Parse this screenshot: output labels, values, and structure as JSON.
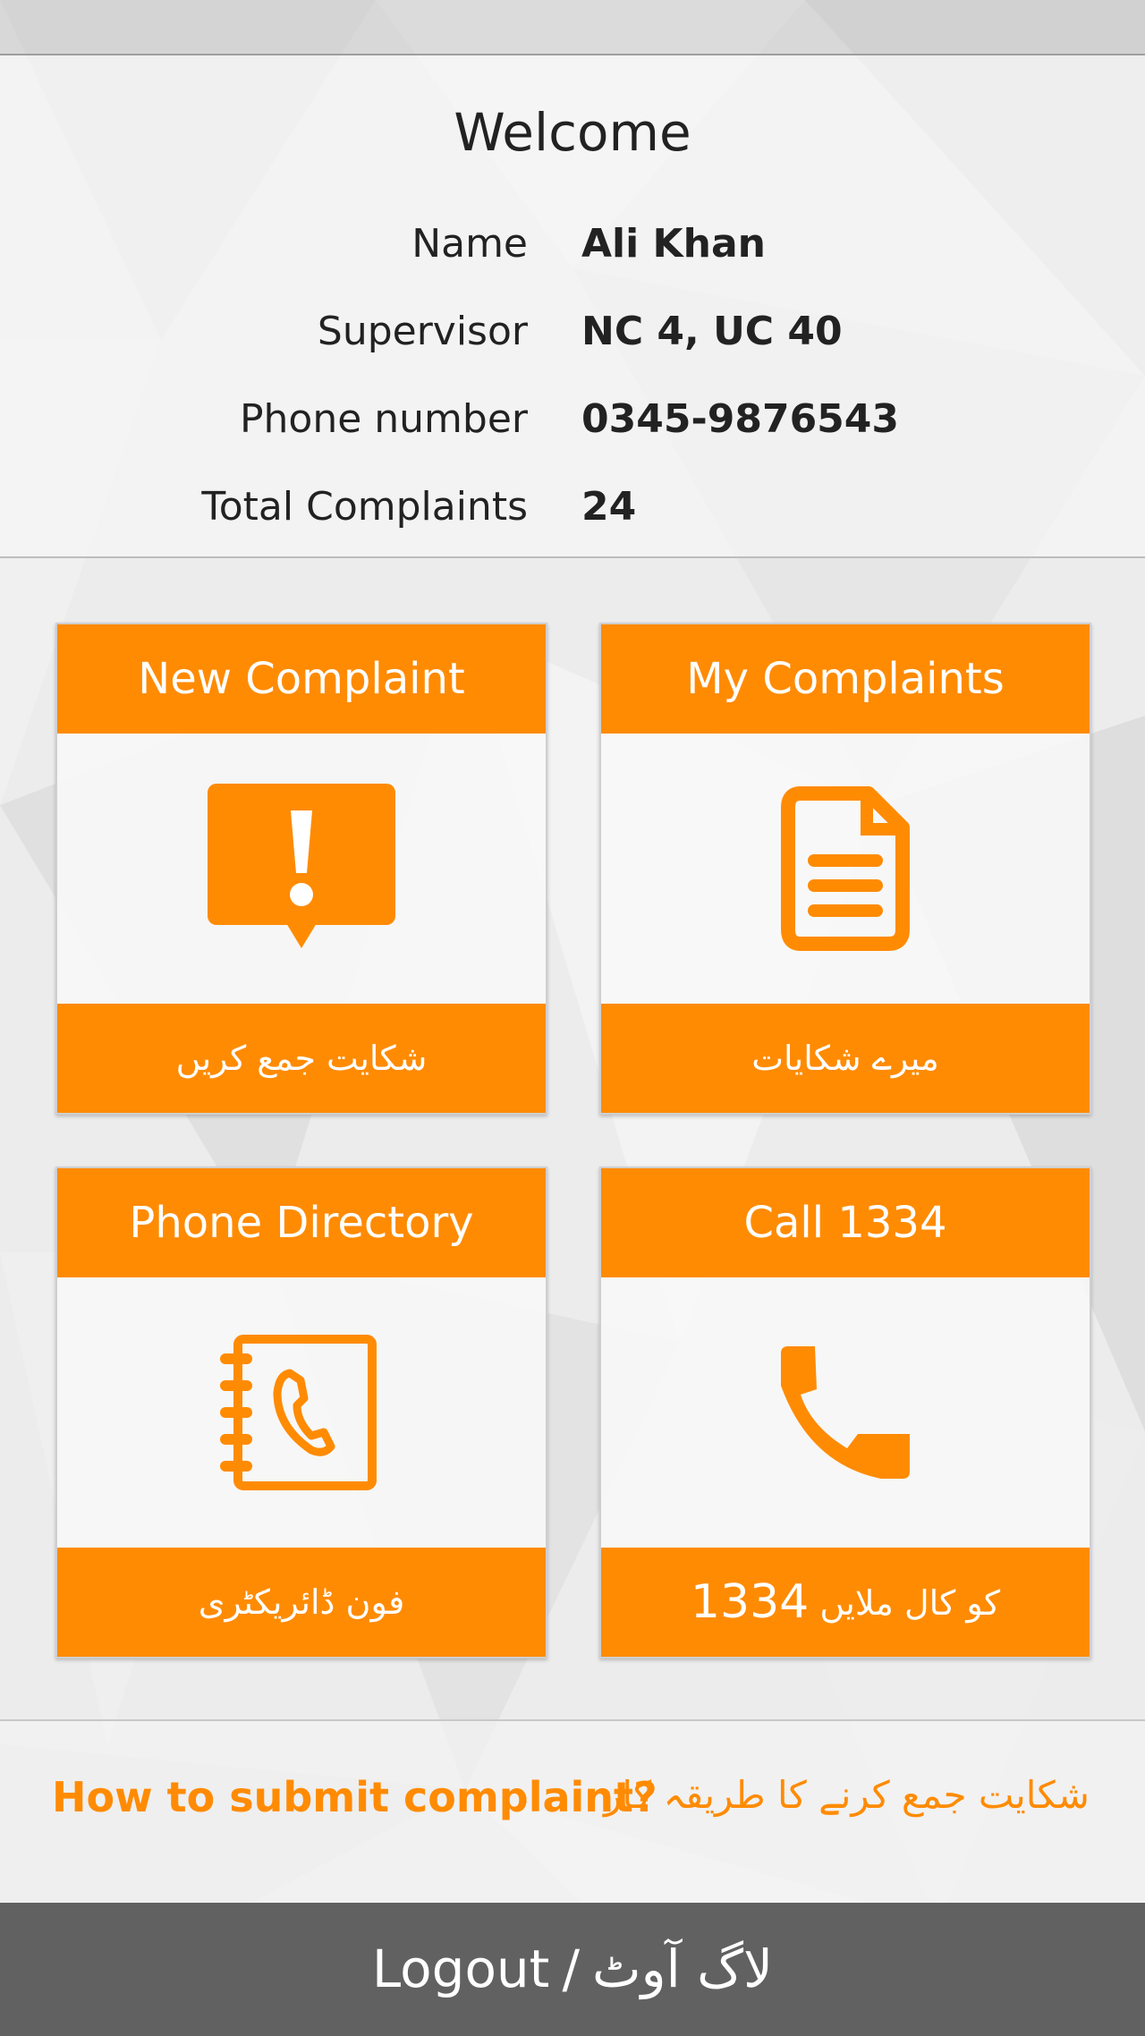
{
  "profile": {
    "welcome": "Welcome",
    "rows": [
      {
        "label": "Name",
        "value": "Ali Khan"
      },
      {
        "label": "Supervisor",
        "value": "NC 4, UC 40"
      },
      {
        "label": "Phone number",
        "value": "0345-9876543"
      },
      {
        "label": "Total Complaints",
        "value": "24"
      }
    ]
  },
  "tiles": {
    "new_complaint": {
      "title": "New Complaint",
      "subtitle": "شکایت جمع کریں",
      "icon": "alert-speech-bubble-icon"
    },
    "my_complaints": {
      "title": "My Complaints",
      "subtitle": "میرے شکایات",
      "icon": "document-icon"
    },
    "phone_directory": {
      "title": "Phone Directory",
      "subtitle": "فون ڈائریکٹری",
      "icon": "address-book-phone-icon"
    },
    "call": {
      "title": "Call 1334",
      "subtitle_number": "1334",
      "subtitle_text": "کو کال ملایں",
      "icon": "phone-handset-icon"
    }
  },
  "howto": {
    "english": "How to submit complaint?",
    "urdu": "شکایت جمع کرنے کا طریقہ کار"
  },
  "logout": {
    "english": "Logout",
    "separator": "/",
    "urdu": "لاگ آوٹ"
  },
  "colors": {
    "accent": "#ff8b03",
    "logout_bar": "#616161",
    "text": "#222222"
  }
}
